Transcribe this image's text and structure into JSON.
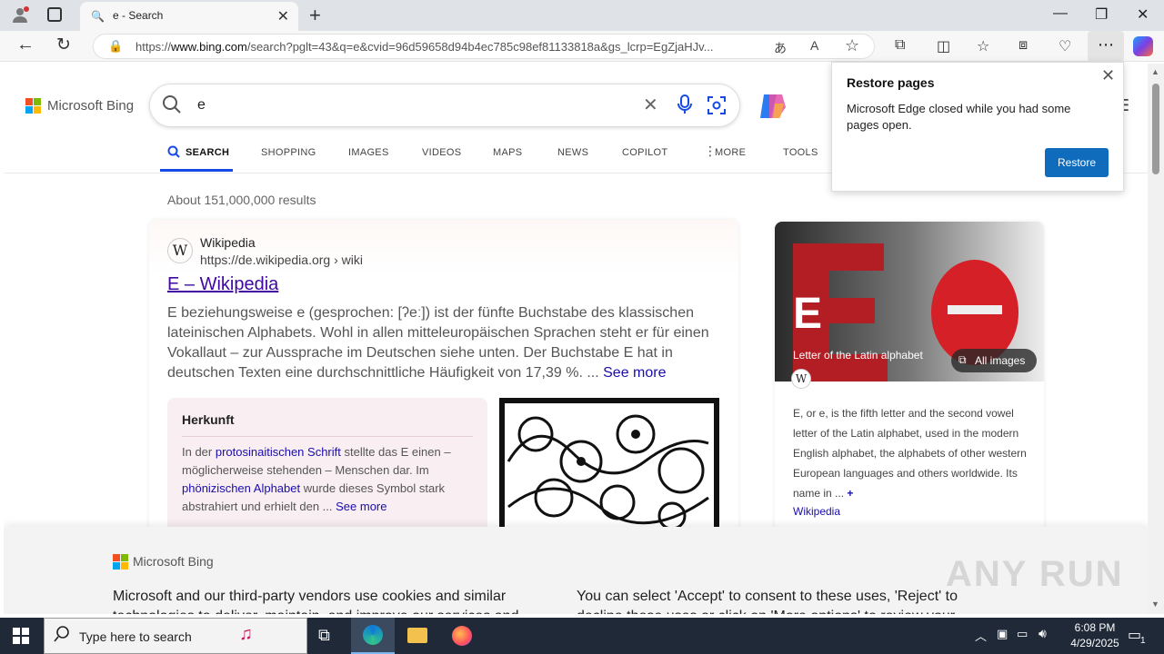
{
  "browser": {
    "tab_title": "e - Search",
    "url_prefix": "https://",
    "url_host": "www.bing.com",
    "url_rest": "/search?pglt=43&q=e&cvid=96d59658d94b4ec785c98ef81133818a&gs_lcrp=EgZjaHJv..."
  },
  "bing": {
    "logo_text": "Microsoft Bing",
    "query": "e",
    "nav": [
      "SEARCH",
      "SHOPPING",
      "IMAGES",
      "VIDEOS",
      "MAPS",
      "NEWS",
      "COPILOT",
      "MORE",
      "TOOLS"
    ],
    "result_count": "About 151,000,000 results"
  },
  "result": {
    "site_name": "Wikipedia",
    "site_url": "https://de.wikipedia.org › wiki",
    "title": "E – Wikipedia",
    "snippet": "E beziehungsweise e (gesprochen: [ʔeː]) ist der fünfte Buchstabe des klassischen lateinischen Alphabets. Wohl in allen mitteleuropäischen Sprachen steht er für einen Vokallaut – zur Aussprache im Deutschen siehe unten. Der Buchstabe E hat in deutschen Texten eine durchschnittliche Häufigkeit von 17,39 %. ...",
    "see_more": "See more",
    "herkunft": {
      "title": "Herkunft",
      "t1": "In der ",
      "l1": "protosinaitischen Schrift",
      "t2": " stellte das E einen – möglicherweise stehenden – Menschen dar. Im ",
      "l2": "phönizischen Alphabet",
      "t3": " wurde dieses Symbol stark abstrahiert und erhielt den ...",
      "see_more": "See more"
    }
  },
  "sidebar": {
    "big_letter": "E",
    "subtitle": "Letter of the Latin alphabet",
    "all_images": "All images",
    "description": "E, or e, is the fifth letter and the second vowel letter of the Latin alphabet, used in the modern English alphabet, the alphabets of other western European languages and others worldwide. Its name in ...",
    "source": "Wikipedia"
  },
  "restore_popup": {
    "title": "Restore pages",
    "body": "Microsoft Edge closed while you had some pages open.",
    "button": "Restore"
  },
  "cookie": {
    "logo_text": "Microsoft Bing",
    "left_text": "Microsoft and our third-party vendors use cookies and similar technologies to deliver, maintain, and improve our services and",
    "right_text": "You can select 'Accept' to consent to these uses, 'Reject' to decline these uses or click on 'More options' to review your"
  },
  "taskbar": {
    "search_placeholder": "Type here to search",
    "time": "6:08 PM",
    "date": "4/29/2025",
    "notification_count": "1"
  },
  "watermark": "ANY RUN",
  "colors": {
    "bing_blue": "#174ae4",
    "link": "#1a0dab",
    "restore_blue": "#0f6cbd"
  }
}
